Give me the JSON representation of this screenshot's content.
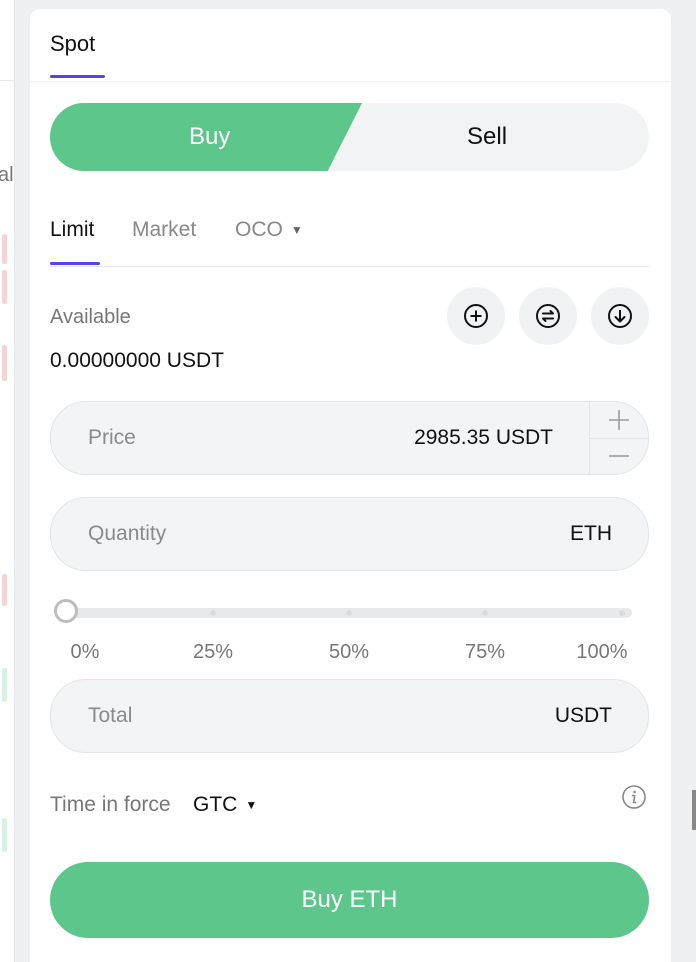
{
  "left_strip": {
    "fragment_text": "al"
  },
  "panel": {
    "spot_tab": "Spot",
    "side_switch": {
      "buy": "Buy",
      "sell": "Sell",
      "buy_color": "#5dc68a"
    },
    "order_tabs": {
      "limit": "Limit",
      "market": "Market",
      "oco": "OCO"
    },
    "available": {
      "label": "Available",
      "value": "0.00000000 USDT"
    },
    "icons": [
      "plus-circle-icon",
      "transfer-icon",
      "download-icon"
    ],
    "price": {
      "label": "Price",
      "value": "2985.35 USDT"
    },
    "quantity": {
      "label": "Quantity",
      "unit": "ETH"
    },
    "slider": {
      "labels": [
        "0%",
        "25%",
        "50%",
        "75%",
        "100%"
      ],
      "value_percent": 0
    },
    "total": {
      "label": "Total",
      "unit": "USDT"
    },
    "time_in_force": {
      "label": "Time in force",
      "value": "GTC"
    },
    "submit": {
      "label": "Buy ETH"
    },
    "accent_color": "#4f46e5"
  }
}
